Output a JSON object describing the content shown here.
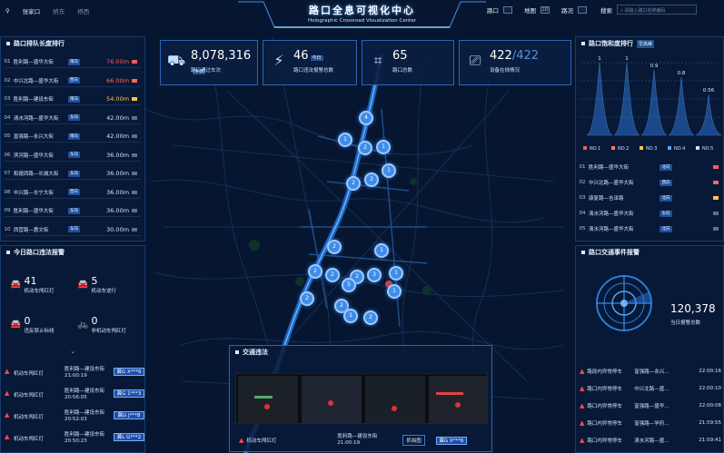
{
  "header": {
    "location": "张家口",
    "districts": [
      "桥东",
      "桥西"
    ],
    "title_cn": "路口全息可视化中心",
    "title_en": "Holographic Crossroad Visualization Center",
    "nav": [
      {
        "label": "路口",
        "toggle": ""
      },
      {
        "label": "地图",
        "toggle": "2D"
      },
      {
        "label": "路况",
        "toggle": ""
      }
    ],
    "search_label": "搜索",
    "search_placeholder": "请输入路口名称编码"
  },
  "queue_panel": {
    "title": "路口排队长度排行",
    "rows": [
      {
        "n": "01",
        "name": "胜利路—盛华大街",
        "tag": "南向",
        "value": "76.00m",
        "color": "#ff5a5a"
      },
      {
        "n": "02",
        "name": "中兴北路—盛华大街",
        "tag": "西向",
        "value": "66.00m",
        "color": "#ff6a5a"
      },
      {
        "n": "03",
        "name": "胜利路—建设东街",
        "tag": "南向",
        "value": "54.00m",
        "color": "#ffc34a"
      },
      {
        "n": "04",
        "name": "清水河路—盛华大街",
        "tag": "东向",
        "value": "42.00m",
        "color": "#cfe3ff"
      },
      {
        "n": "05",
        "name": "富强路—永兴大街",
        "tag": "南向",
        "value": "42.00m",
        "color": "#cfe3ff"
      },
      {
        "n": "06",
        "name": "滨河路—盛华大街",
        "tag": "东向",
        "value": "36.00m",
        "color": "#cfe3ff"
      },
      {
        "n": "07",
        "name": "和德西路—长城大街",
        "tag": "东向",
        "value": "36.00m",
        "color": "#cfe3ff"
      },
      {
        "n": "08",
        "name": "中兴路—长宁大街",
        "tag": "西向",
        "value": "36.00m",
        "color": "#cfe3ff"
      },
      {
        "n": "09",
        "name": "胜利路—盛华大街",
        "tag": "东向",
        "value": "36.00m",
        "color": "#cfe3ff"
      },
      {
        "n": "10",
        "name": "西营路—惠文街",
        "tag": "东向",
        "value": "30.00m",
        "color": "#cfe3ff"
      }
    ]
  },
  "violation_panel": {
    "title": "今日路口违法报警",
    "items": [
      {
        "value": "41",
        "label": "机动车闯红灯"
      },
      {
        "value": "5",
        "label": "机动车逆行"
      },
      {
        "value": "0",
        "label": "违反禁止标线"
      },
      {
        "value": "0",
        "label": "非机动车闯红灯"
      }
    ],
    "alarms": [
      {
        "type": "机动车闯红灯",
        "road": "胜利路—建设东街",
        "time": "21:00:19",
        "plate": "冀G X***6"
      },
      {
        "type": "机动车闯红灯",
        "road": "胜利路—建设东街",
        "time": "20:56:05",
        "plate": "冀G 1***3"
      },
      {
        "type": "机动车闯红灯",
        "road": "胜利路—建设东街",
        "time": "20:52:03",
        "plate": "冀G J***8"
      },
      {
        "type": "机动车闯红灯",
        "road": "胜利路—建设东街",
        "time": "20:50:23",
        "plate": "冀L G***2"
      }
    ]
  },
  "kpis": [
    {
      "value": "8,078,316",
      "unit": "今日",
      "label": "路口通过车次",
      "icon": "car-icon"
    },
    {
      "value": "46",
      "unit": "今日",
      "label": "路口违法报警总数",
      "icon": "alarm-icon"
    },
    {
      "value": "65",
      "unit": "",
      "label": "路口总数",
      "icon": "crossroad-icon"
    },
    {
      "value": "422",
      "value2": "/422",
      "unit": "",
      "label": "设备在线情况",
      "icon": "camera-icon"
    }
  ],
  "saturation_panel": {
    "title": "路口饱和度排行",
    "tag": "早高峰",
    "legend": [
      "NO.1",
      "NO.2",
      "NO.3",
      "NO.4",
      "NO.5"
    ],
    "rows": [
      {
        "n": "01",
        "name": "胜利路—盛华大街",
        "tag": "北向",
        "color": "#ff5a5a"
      },
      {
        "n": "02",
        "name": "中兴北路—盛华大街",
        "tag": "西向",
        "color": "#ff6a5a"
      },
      {
        "n": "03",
        "name": "康复路—吉泽路",
        "tag": "北向",
        "color": "#ffc34a"
      },
      {
        "n": "04",
        "name": "清水河路—盛华大街",
        "tag": "东向",
        "color": "#cfe3ff"
      },
      {
        "n": "05",
        "name": "清水河路—盛华大街",
        "tag": "北向",
        "color": "#cfe3ff"
      }
    ]
  },
  "chart_data": {
    "type": "area",
    "categories": [
      "NO.1",
      "NO.2",
      "NO.3",
      "NO.4",
      "NO.5"
    ],
    "values": [
      1,
      1,
      0.9,
      0.8,
      0.56
    ],
    "value_labels": [
      "1",
      "1",
      "0.9",
      "0.8",
      "0.56"
    ],
    "series_colors": [
      "#ff5a5a",
      "#ff7a5a",
      "#ffc34a",
      "#5aa0ff",
      "#cfe3ff"
    ]
  },
  "event_panel": {
    "title": "路口交通事件报警",
    "count": "120,378",
    "count_label": "当日报警总数",
    "rows": [
      {
        "type": "路段内异常停车",
        "road": "富强路—永兴...",
        "time": "22:00:16"
      },
      {
        "type": "路口内异常停车",
        "road": "中兴北路—盛...",
        "time": "22:00:10"
      },
      {
        "type": "路口内异常停车",
        "road": "富强路—盛华...",
        "time": "22:00:08"
      },
      {
        "type": "路口内异常停车",
        "road": "富强路—学府...",
        "time": "21:59:55"
      },
      {
        "type": "路口内异常停车",
        "road": "清水河路—盛...",
        "time": "21:59:41"
      }
    ]
  },
  "popup": {
    "title": "交通违法",
    "type": "机动车闯红灯",
    "road": "胜利路—建设东街",
    "time": "21:00:19",
    "button": "抓拍图",
    "plate": "冀G X***6"
  },
  "map": {
    "clusters": [
      {
        "t": "4"
      },
      {
        "t": "1"
      },
      {
        "t": "2"
      },
      {
        "t": "1"
      },
      {
        "t": "1"
      },
      {
        "t": "2"
      },
      {
        "t": "2"
      },
      {
        "t": "2"
      },
      {
        "t": "1"
      },
      {
        "t": "2"
      },
      {
        "t": "1"
      },
      {
        "t": "2"
      },
      {
        "t": "2"
      },
      {
        "t": "3"
      },
      {
        "t": "5"
      },
      {
        "t": "1"
      },
      {
        "t": "2"
      },
      {
        "t": "2"
      },
      {
        "t": "1"
      },
      {
        "t": "2"
      }
    ]
  }
}
